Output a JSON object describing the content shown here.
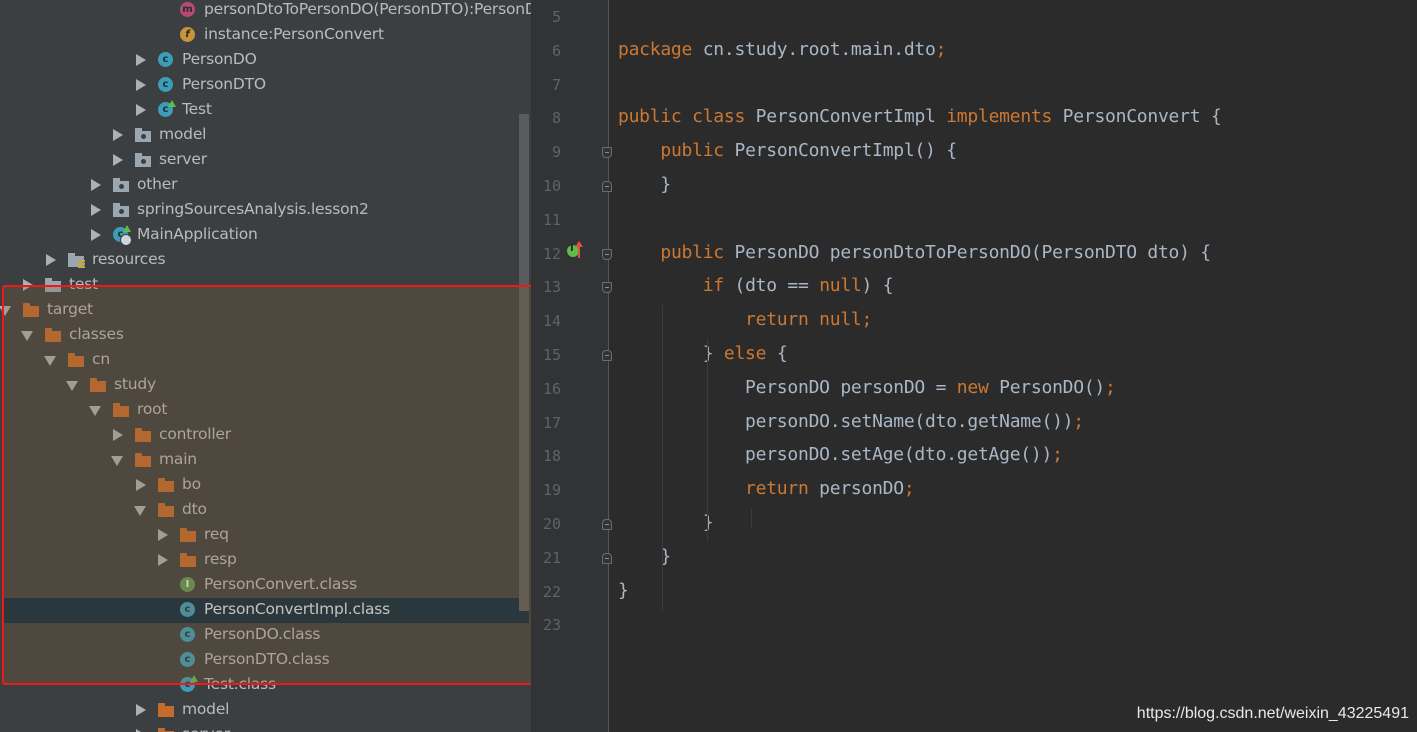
{
  "project_tree": {
    "items": [
      {
        "label": "personDtoToPersonDO(PersonDTO):PersonD",
        "icon": "method-icon",
        "expander": "none"
      },
      {
        "label": "instance:PersonConvert",
        "icon": "field-icon",
        "expander": "none"
      },
      {
        "label": "PersonDO",
        "icon": "class-icon",
        "expander": "collapsed"
      },
      {
        "label": "PersonDTO",
        "icon": "class-icon",
        "expander": "collapsed"
      },
      {
        "label": "Test",
        "icon": "runnable-class-icon",
        "expander": "collapsed"
      },
      {
        "label": "model",
        "icon": "package-folder-icon",
        "expander": "collapsed"
      },
      {
        "label": "server",
        "icon": "package-folder-icon",
        "expander": "collapsed"
      },
      {
        "label": "other",
        "icon": "package-folder-icon",
        "expander": "collapsed"
      },
      {
        "label": "springSourcesAnalysis.lesson2",
        "icon": "package-folder-icon",
        "expander": "collapsed"
      },
      {
        "label": "MainApplication",
        "icon": "spring-boot-class-icon",
        "expander": "collapsed"
      },
      {
        "label": "resources",
        "icon": "resources-folder-icon",
        "expander": "collapsed"
      },
      {
        "label": "test",
        "icon": "grey-folder-icon",
        "expander": "collapsed"
      },
      {
        "label": "target",
        "icon": "excluded-folder-icon",
        "expander": "expanded"
      },
      {
        "label": "classes",
        "icon": "excluded-folder-icon",
        "expander": "expanded"
      },
      {
        "label": "cn",
        "icon": "excluded-folder-icon",
        "expander": "expanded"
      },
      {
        "label": "study",
        "icon": "excluded-folder-icon",
        "expander": "expanded"
      },
      {
        "label": "root",
        "icon": "excluded-folder-icon",
        "expander": "expanded"
      },
      {
        "label": "controller",
        "icon": "excluded-folder-icon",
        "expander": "collapsed"
      },
      {
        "label": "main",
        "icon": "excluded-folder-icon",
        "expander": "expanded"
      },
      {
        "label": "bo",
        "icon": "excluded-folder-icon",
        "expander": "collapsed"
      },
      {
        "label": "dto",
        "icon": "excluded-folder-icon",
        "expander": "expanded"
      },
      {
        "label": "req",
        "icon": "excluded-folder-icon",
        "expander": "collapsed"
      },
      {
        "label": "resp",
        "icon": "excluded-folder-icon",
        "expander": "collapsed"
      },
      {
        "label": "PersonConvert.class",
        "icon": "interface-class-file-icon",
        "expander": "none"
      },
      {
        "label": "PersonConvertImpl.class",
        "icon": "class-file-icon",
        "expander": "none",
        "selected": true
      },
      {
        "label": "PersonDO.class",
        "icon": "class-file-icon",
        "expander": "none"
      },
      {
        "label": "PersonDTO.class",
        "icon": "class-file-icon",
        "expander": "none"
      },
      {
        "label": "Test.class",
        "icon": "runnable-class-file-icon",
        "expander": "none"
      },
      {
        "label": "model",
        "icon": "excluded-folder-icon",
        "expander": "collapsed"
      },
      {
        "label": "server",
        "icon": "excluded-folder-icon",
        "expander": "collapsed"
      }
    ]
  },
  "editor": {
    "lines": [
      {
        "num": "5",
        "code": ""
      },
      {
        "num": "6",
        "code": "package cn.study.root.main.dto;"
      },
      {
        "num": "7",
        "code": ""
      },
      {
        "num": "8",
        "code": "public class PersonConvertImpl implements PersonConvert {"
      },
      {
        "num": "9",
        "code": "    public PersonConvertImpl() {"
      },
      {
        "num": "10",
        "code": "    }"
      },
      {
        "num": "11",
        "code": ""
      },
      {
        "num": "12",
        "code": "    public PersonDO personDtoToPersonDO(PersonDTO dto) {"
      },
      {
        "num": "13",
        "code": "        if (dto == null) {"
      },
      {
        "num": "14",
        "code": "            return null;"
      },
      {
        "num": "15",
        "code": "        } else {"
      },
      {
        "num": "16",
        "code": "            PersonDO personDO = new PersonDO();"
      },
      {
        "num": "17",
        "code": "            personDO.setName(dto.getName());"
      },
      {
        "num": "18",
        "code": "            personDO.setAge(dto.getAge());"
      },
      {
        "num": "19",
        "code": "            return personDO;"
      },
      {
        "num": "20",
        "code": "        }"
      },
      {
        "num": "21",
        "code": "    }"
      },
      {
        "num": "22",
        "code": "}"
      },
      {
        "num": "23",
        "code": ""
      }
    ],
    "keywords": [
      "package",
      "public",
      "class",
      "implements",
      "if",
      "null",
      "return",
      "else",
      "new"
    ]
  },
  "watermark": "https://blog.csdn.net/weixin_43225491",
  "colors": {
    "keyword": "#cc7832",
    "text": "#a9b7c6",
    "highlight_border": "#f01818",
    "selection": "#0d293e"
  }
}
